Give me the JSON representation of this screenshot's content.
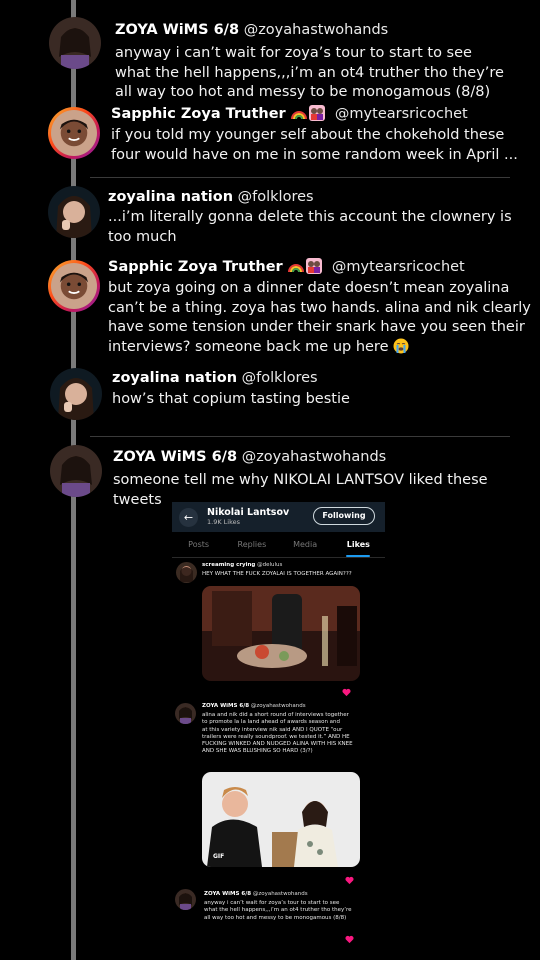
{
  "tweets": [
    {
      "name": "ZOYA WiMS 6/8",
      "handle": "@zoyahastwohands",
      "text": "anyway i can’t wait for zoya’s tour to start to see\nwhat the hell happens,,,i’m an ot4 truther tho they’re\nall way too hot and messy to be monogamous (8/8)"
    },
    {
      "name": "Sapphic Zoya Truther",
      "handle": "@mytearsricochet",
      "text": "if you told my younger self about the chokehold these\nfour would have on me in some random week in April ..."
    },
    {
      "name": "zoyalina nation",
      "handle": "@folklores",
      "text": "...i’m literally gonna delete this account the clownery is\ntoo much"
    },
    {
      "name": "Sapphic Zoya Truther",
      "handle": "@mytearsricochet",
      "text": "but zoya going on a dinner date doesn’t mean zoyalina\ncan’t be a thing. zoya has two hands. alina and nik clearly\nhave some tension under their snark have you seen their\ninterviews? someone back me up here"
    },
    {
      "name": "zoyalina nation",
      "handle": "@folklores",
      "text": "how’s that copium tasting bestie"
    },
    {
      "name": "ZOYA WiMS 6/8",
      "handle": "@zoyahastwohands",
      "text": "someone tell me why NIKOLAI LANTSOV liked these tweets"
    }
  ],
  "embed": {
    "profile_name": "Nikolai Lantsov",
    "likes_count": "1.9K Likes",
    "follow_label": "Following",
    "tabs": [
      "Posts",
      "Replies",
      "Media",
      "Likes"
    ],
    "active_tab": "Likes",
    "liked": [
      {
        "name": "screaming crying",
        "handle": "@delulus",
        "text": "HEY WHAT THE FUCK ZOYALAI IS TOGETHER AGAIN???"
      },
      {
        "name": "ZOYA WiMS 6/8",
        "handle": "@zoyahastwohands",
        "text": "alina and nik did a short round of interviews together\nto promote la la land ahead of awards season and\nat this variety interview nik said AND I QUOTE “our\ntrailers were really soundproof. we tested it.” AND HE\nFUCKING WINKED AND NUDGED ALINA WITH HIS KNEE\nAND SHE WAS BLUSHING SO HARD (3/?)",
        "gif_label": "GIF"
      },
      {
        "name": "ZOYA WiMS 6/8",
        "handle": "@zoyahastwohands",
        "text": "anyway i can’t wait for zoya’s tour to start to see\nwhat the hell happens,,,i’m an ot4 truther tho they’re\nall way too hot and messy to be monogamous (8/8)"
      }
    ]
  },
  "colors": {
    "background": "#000000",
    "thread_line": "#7a7a7a",
    "like_heart": "#f91880",
    "accent": "#1d9bf0"
  }
}
